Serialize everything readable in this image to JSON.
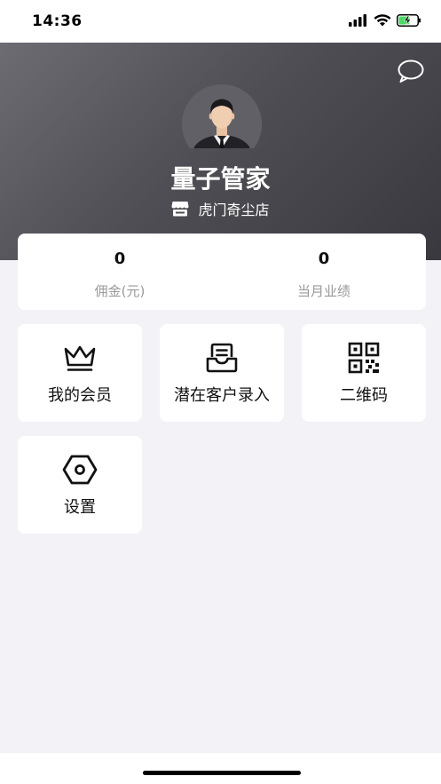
{
  "status_bar": {
    "time": "14:36"
  },
  "header": {
    "user_name": "量子管家",
    "store_name": "虎门奇尘店"
  },
  "stats": [
    {
      "value": "0",
      "label": "佣金(元)"
    },
    {
      "value": "0",
      "label": "当月业绩"
    }
  ],
  "menu": [
    {
      "label": "我的会员",
      "icon": "crown-icon"
    },
    {
      "label": "潜在客户录入",
      "icon": "inbox-icon"
    },
    {
      "label": "二维码",
      "icon": "qr-code-icon"
    },
    {
      "label": "设置",
      "icon": "hexagon-settings-icon"
    }
  ],
  "colors": {
    "header_dark": "#38383e",
    "header_light": "#6c6c72",
    "page_background": "#f3f3f7",
    "label_gray": "#999999",
    "battery_green": "#4cd964"
  }
}
